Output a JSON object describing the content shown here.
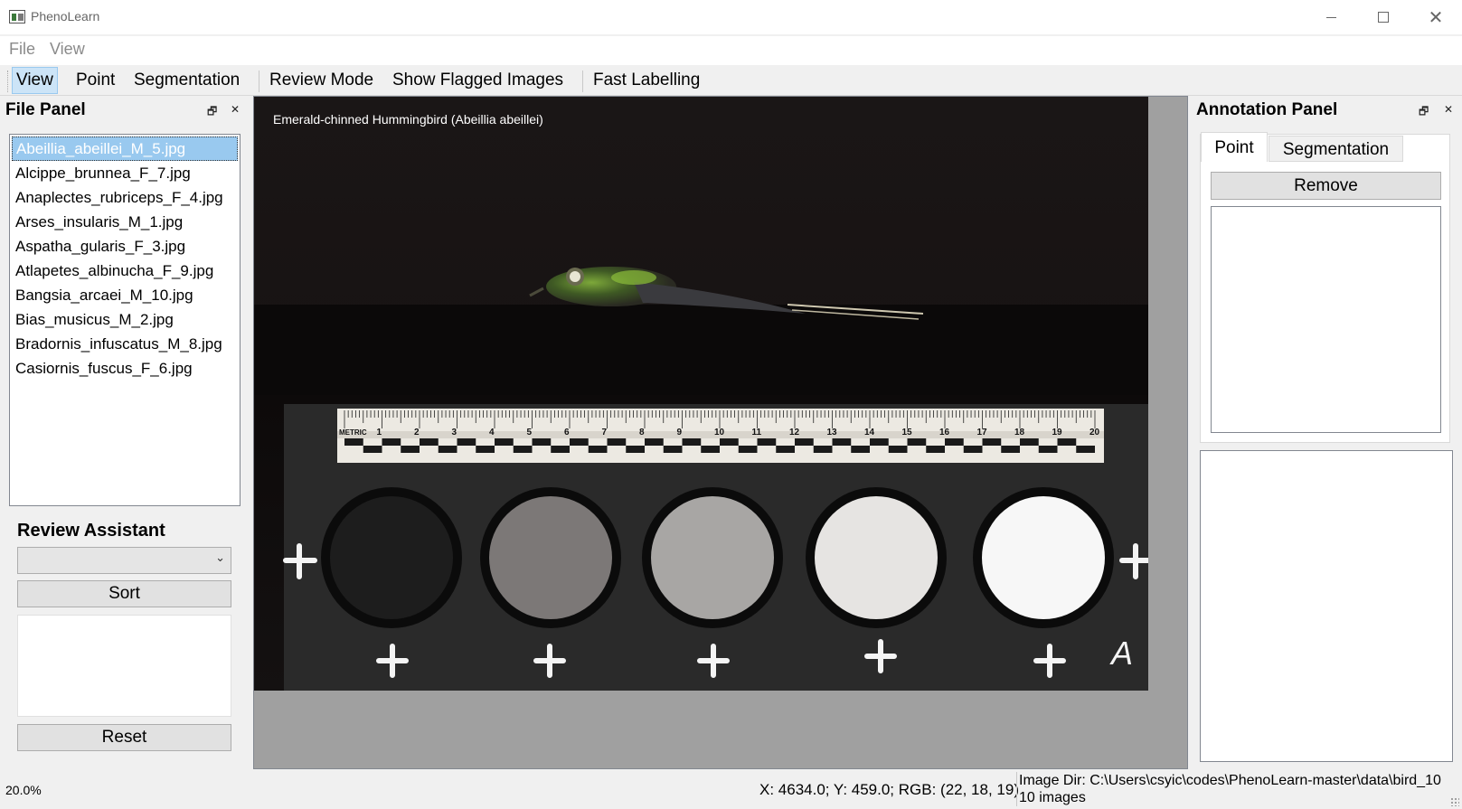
{
  "window": {
    "title": "PhenoLearn",
    "icons": {
      "app": "app-icon",
      "minimize": "minimize-icon",
      "maximize": "maximize-icon",
      "close": "close-icon"
    },
    "close_glyph": "✕"
  },
  "menubar": {
    "items": [
      "File",
      "View"
    ]
  },
  "toolbar": {
    "buttons": [
      "View",
      "Point",
      "Segmentation",
      "Review Mode",
      "Show Flagged Images",
      "Fast Labelling"
    ],
    "active": "View",
    "active_color": "#cce4f7"
  },
  "file_panel": {
    "title": "File Panel",
    "float_glyph": "🗗",
    "close_glyph": "✕",
    "files": [
      "Abeillia_abeillei_M_5.jpg",
      "Alcippe_brunnea_F_7.jpg",
      "Anaplectes_rubriceps_F_4.jpg",
      "Arses_insularis_M_1.jpg",
      "Aspatha_gularis_F_3.jpg",
      "Atlapetes_albinucha_F_9.jpg",
      "Bangsia_arcaei_M_10.jpg",
      "Bias_musicus_M_2.jpg",
      "Bradornis_infuscatus_M_8.jpg",
      "Casiornis_fuscus_F_6.jpg"
    ],
    "selected_index": 0,
    "selected_color": "#99c9ef"
  },
  "review_assistant": {
    "title": "Review Assistant",
    "combo_value": "",
    "combo_glyph": "⌄",
    "sort_label": "Sort",
    "reset_label": "Reset"
  },
  "viewer": {
    "caption": "Emerald-chinned Hummingbird (Abeillia abeillei)",
    "ruler": {
      "label": "METRIC",
      "numbers": [
        "1",
        "2",
        "3",
        "4",
        "5",
        "6",
        "7",
        "8",
        "9",
        "10",
        "11",
        "12",
        "13",
        "14",
        "15",
        "16",
        "17",
        "18",
        "19",
        "20"
      ]
    },
    "corner_letter": "A",
    "background_color": "#151212"
  },
  "annotation_panel": {
    "title": "Annotation Panel",
    "float_glyph": "🗗",
    "close_glyph": "✕",
    "tabs": [
      "Point",
      "Segmentation"
    ],
    "active_tab": "Point",
    "remove_label": "Remove"
  },
  "status_bar": {
    "zoom": "20.0%",
    "coords": "X: 4634.0; Y: 459.0; RGB: (22, 18, 19)",
    "image_dir": "Image Dir: C:\\Users\\csyic\\codes\\PhenoLearn-master\\data\\bird_10",
    "image_count": "10 images"
  }
}
